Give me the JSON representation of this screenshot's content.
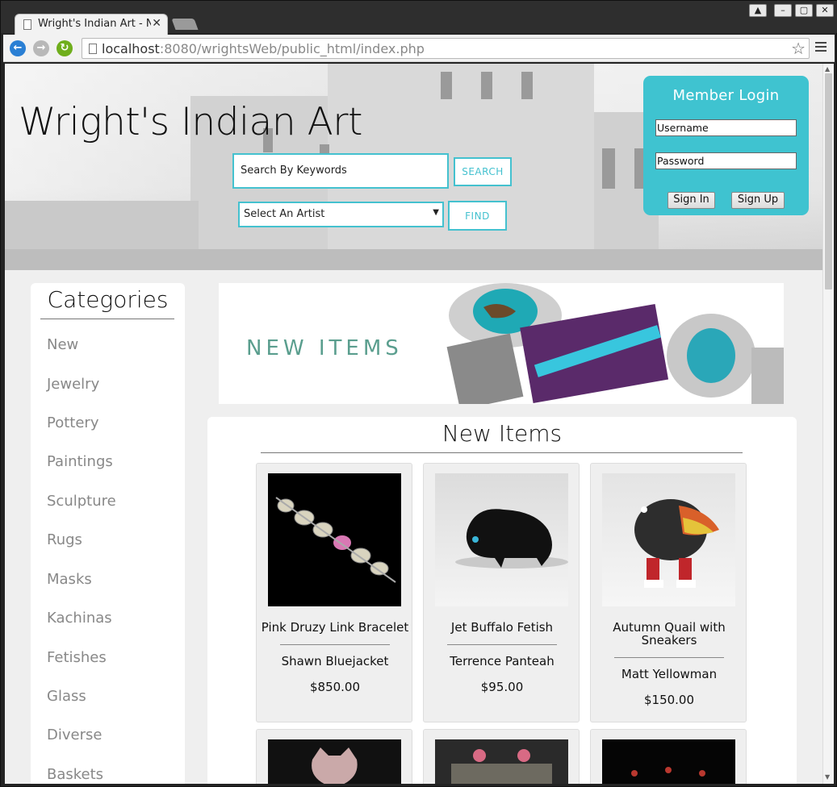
{
  "browser": {
    "tab_title": "Wright's Indian Art - N",
    "url_host": "localhost",
    "url_rest": ":8080/wrightsWeb/public_html/index.php"
  },
  "header": {
    "site_title": "Wright's Indian Art",
    "search_placeholder": "Search By Keywords",
    "search_button": "SEARCH",
    "artist_select_value": "Select An Artist",
    "find_button": "FIND"
  },
  "login": {
    "title": "Member Login",
    "username_placeholder": "Username",
    "password_placeholder": "Password",
    "sign_in": "Sign In",
    "sign_up": "Sign Up"
  },
  "sidebar": {
    "title": "Categories",
    "items": [
      "New",
      "Jewelry",
      "Pottery",
      "Paintings",
      "Sculpture",
      "Rugs",
      "Masks",
      "Kachinas",
      "Fetishes",
      "Glass",
      "Diverse",
      "Baskets"
    ]
  },
  "banner": {
    "text": "NEW ITEMS"
  },
  "products": {
    "title": "New Items",
    "items": [
      {
        "name": "Pink Druzy Link Bracelet",
        "artist": "Shawn Bluejacket",
        "price": "$850.00"
      },
      {
        "name": "Jet Buffalo Fetish",
        "artist": "Terrence Panteah",
        "price": "$95.00"
      },
      {
        "name": "Autumn Quail with Sneakers",
        "artist": "Matt Yellowman",
        "price": "$150.00"
      }
    ]
  },
  "colors": {
    "accent": "#44c1cf",
    "login_bg": "#3fc3d0",
    "banner_text": "#5a9e8e"
  }
}
